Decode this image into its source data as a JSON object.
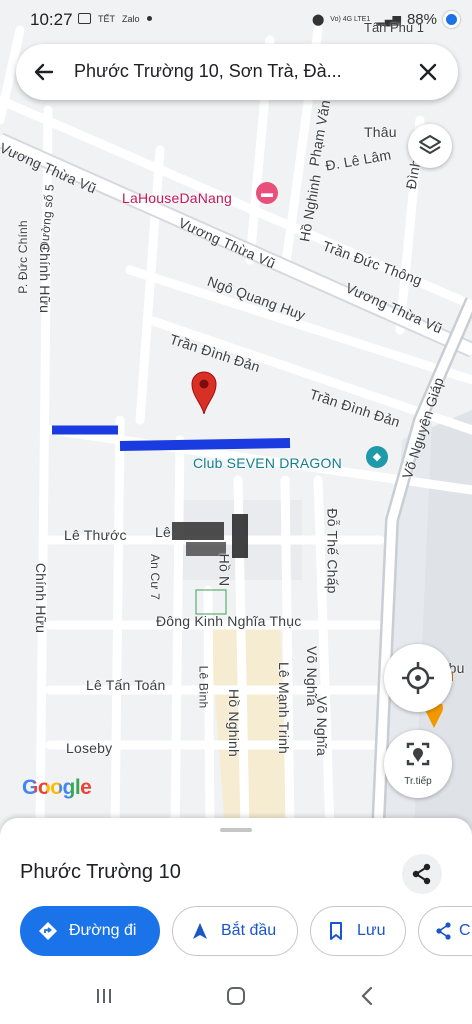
{
  "status": {
    "time": "10:27",
    "notif_a": "TẾT",
    "notif_b": "Zalo",
    "net": "Vo) 4G LTE1",
    "battery": "88%",
    "overlay_place": "Tân Phú 1"
  },
  "search": {
    "query": "Phước Trường 10, Sơn Trà, Đà...",
    "back_icon": "arrow-back-icon",
    "close_icon": "close-icon"
  },
  "map": {
    "poi": {
      "hotel": "LaHouseDaNang",
      "club": "Club SEVEN DRAGON"
    },
    "streets": {
      "vuong_thua_vu_1": "Vương Thừa Vũ",
      "vuong_thua_vu_2": "Vương Thừa Vũ",
      "vuong_thua_vu_3": "Vương Thừa Vũ",
      "tran_duc_thong": "Trần Đức Thông",
      "ngo_quang_huy": "Ngô Quang Huy",
      "tran_dinh_dan_1": "Trần Đình Đản",
      "tran_dinh_dan_2": "Trần Đình Đản",
      "le_lam": "Đ. Lê Lâm",
      "thau": "Thâu",
      "ho_nghinh": "Hồ Nghinh",
      "pham_van": "Phạm Văn",
      "p_duc_chinh": "P. Đức Chính",
      "chinh_huu_1": "Chính Hữu",
      "chinh_huu_2": "Chính Hữu",
      "le_thuoc": "Lê Thước",
      "le_thuoc_2": "Lê",
      "an_cu_7": "An Cư 7",
      "dong_kinh_nghia_thuc": "Đông Kinh Nghĩa Thục",
      "le_tan_toan": "Lê Tấn Toán",
      "le_binh": "Lê Bình",
      "ho_nghinh_2": "Hồ Nghinh",
      "le_manh_trinh": "Lê Mạnh Trinh",
      "vo_nghia_1": "Võ Nghĩa",
      "vo_nghia_2": "Võ Nghĩa",
      "do_the_chap": "Đỗ Thế Chấp",
      "vo_nguyen_giap": "Võ Nguyên Giáp",
      "loseby": "Loseby",
      "nibu": "Nibu",
      "ni": "NI",
      "dinh": "Đình",
      "duong_so_5": "Đường số 5",
      "ho_nghinh_3": "Hồ N",
      "phan": "Ph"
    },
    "google_logo": "Google",
    "tr_tiep": "Tr.tiếp"
  },
  "sheet": {
    "place_name": "Phước Trường 10",
    "share_icon": "share-icon",
    "actions": [
      {
        "label": "Đường đi",
        "icon": "directions-icon"
      },
      {
        "label": "Bắt đầu",
        "icon": "navigate-arrow-icon"
      },
      {
        "label": "Lưu",
        "icon": "bookmark-icon"
      },
      {
        "label": "C",
        "icon": "share-icon"
      }
    ]
  },
  "colors": {
    "accent": "#1a73e8",
    "pin": "#d93025",
    "highlight_road": "#1a3be0",
    "poi_pink": "#e8507b",
    "poi_teal": "#1e9aa8"
  }
}
